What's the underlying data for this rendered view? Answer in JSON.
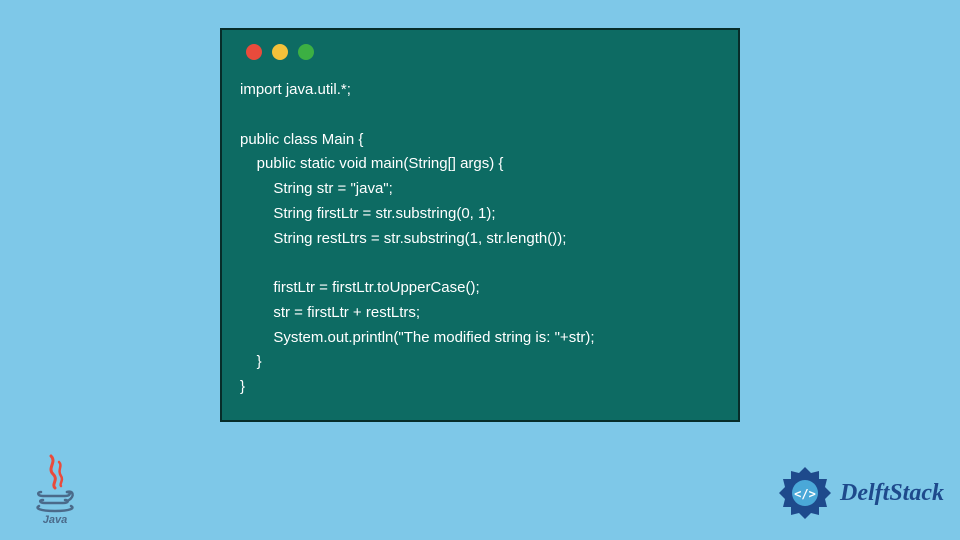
{
  "code_window": {
    "dots": [
      "red",
      "yellow",
      "green"
    ],
    "code_lines": [
      "import java.util.*;",
      "",
      "public class Main {",
      "    public static void main(String[] args) {",
      "        String str = \"java\";",
      "        String firstLtr = str.substring(0, 1);",
      "        String restLtrs = str.substring(1, str.length());",
      "",
      "        firstLtr = firstLtr.toUpperCase();",
      "        str = firstLtr + restLtrs;",
      "        System.out.println(\"The modified string is: \"+str);",
      "    }",
      "}"
    ]
  },
  "logos": {
    "java_label": "Java",
    "delft_label": "DelftStack"
  },
  "colors": {
    "background": "#7ec8e8",
    "window_bg": "#0d6b63",
    "window_border": "#072d2a",
    "code_text": "#ffffff",
    "delft_blue": "#1e4a8c",
    "java_red": "#e94b3c",
    "java_blue": "#4a6a8a"
  }
}
